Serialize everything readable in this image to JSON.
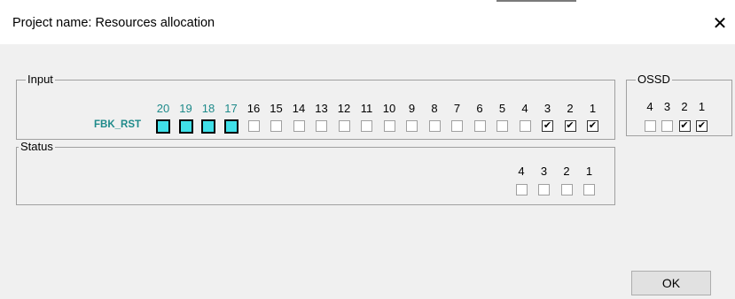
{
  "window": {
    "title": "Project name: Resources allocation",
    "close_glyph": "✕"
  },
  "input_group": {
    "label": "Input",
    "fbk_label": "FBK_RST",
    "channels": [
      {
        "num": "20",
        "fbk": true,
        "checked": false
      },
      {
        "num": "19",
        "fbk": true,
        "checked": false
      },
      {
        "num": "18",
        "fbk": true,
        "checked": false
      },
      {
        "num": "17",
        "fbk": true,
        "checked": false
      },
      {
        "num": "16",
        "fbk": false,
        "checked": false
      },
      {
        "num": "15",
        "fbk": false,
        "checked": false
      },
      {
        "num": "14",
        "fbk": false,
        "checked": false
      },
      {
        "num": "13",
        "fbk": false,
        "checked": false
      },
      {
        "num": "12",
        "fbk": false,
        "checked": false
      },
      {
        "num": "11",
        "fbk": false,
        "checked": false
      },
      {
        "num": "10",
        "fbk": false,
        "checked": false
      },
      {
        "num": "9",
        "fbk": false,
        "checked": false
      },
      {
        "num": "8",
        "fbk": false,
        "checked": false
      },
      {
        "num": "7",
        "fbk": false,
        "checked": false
      },
      {
        "num": "6",
        "fbk": false,
        "checked": false
      },
      {
        "num": "5",
        "fbk": false,
        "checked": false
      },
      {
        "num": "4",
        "fbk": false,
        "checked": false
      },
      {
        "num": "3",
        "fbk": false,
        "checked": true
      },
      {
        "num": "2",
        "fbk": false,
        "checked": true
      },
      {
        "num": "1",
        "fbk": false,
        "checked": true
      }
    ]
  },
  "ossd_group": {
    "label": "OSSD",
    "channels": [
      {
        "num": "4",
        "checked": false
      },
      {
        "num": "3",
        "checked": false
      },
      {
        "num": "2",
        "checked": true
      },
      {
        "num": "1",
        "checked": true
      }
    ]
  },
  "status_group": {
    "label": "Status",
    "channels": [
      {
        "num": "4",
        "checked": false
      },
      {
        "num": "3",
        "checked": false
      },
      {
        "num": "2",
        "checked": false
      },
      {
        "num": "1",
        "checked": false
      }
    ]
  },
  "buttons": {
    "ok_label": "OK"
  },
  "colors": {
    "teal_text": "#1e8a8a",
    "fbk_fill": "#40e0e8",
    "dialog_bg": "#f0f0f0"
  }
}
